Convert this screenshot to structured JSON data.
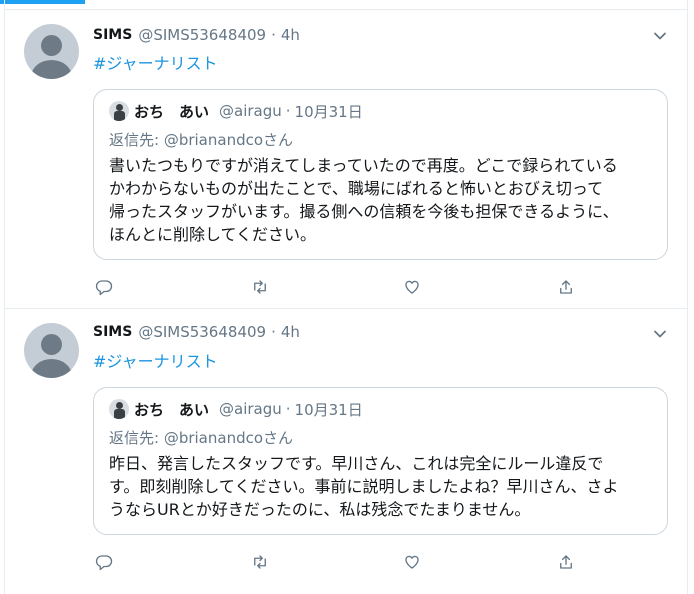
{
  "tweets": [
    {
      "author": {
        "name": "SIMS",
        "handle": "@SIMS53648409"
      },
      "dot": "·",
      "time": "4h",
      "hashtag": "#ジャーナリスト",
      "quote": {
        "name": "おち　あい",
        "handle": "@airagu",
        "dot": "·",
        "date": "10月31日",
        "reply_to": "返信先: @brianandcoさん",
        "lines": [
          "書いたつもりですが消えてしまっていたので再度。どこで録られている",
          "かわからないものが出たことで、職場にばれると怖いとおびえ切って",
          "帰ったスタッフがいます。撮る側への信頼を今後も担保できるように、",
          "ほんとに削除してください。"
        ]
      }
    },
    {
      "author": {
        "name": "SIMS",
        "handle": "@SIMS53648409"
      },
      "dot": "·",
      "time": "4h",
      "hashtag": "#ジャーナリスト",
      "quote": {
        "name": "おち　あい",
        "handle": "@airagu",
        "dot": "·",
        "date": "10月31日",
        "reply_to": "返信先: @brianandcoさん",
        "lines": [
          "昨日、発言したスタッフです。早川さん、これは完全にルール違反で",
          "す。即刻削除してください。事前に説明しましたよね？早川さん、さよ",
          "うならURとか好きだったのに、私は残念でたまりません。"
        ]
      }
    }
  ],
  "icons": {
    "reply": "reply-icon",
    "retweet": "retweet-icon",
    "like": "heart-icon",
    "share": "share-icon",
    "more": "chevron-down-icon"
  },
  "colors": {
    "accent": "#1da1f2",
    "link": "#1b95e0",
    "muted": "#657786",
    "border": "#ccd6dd"
  }
}
